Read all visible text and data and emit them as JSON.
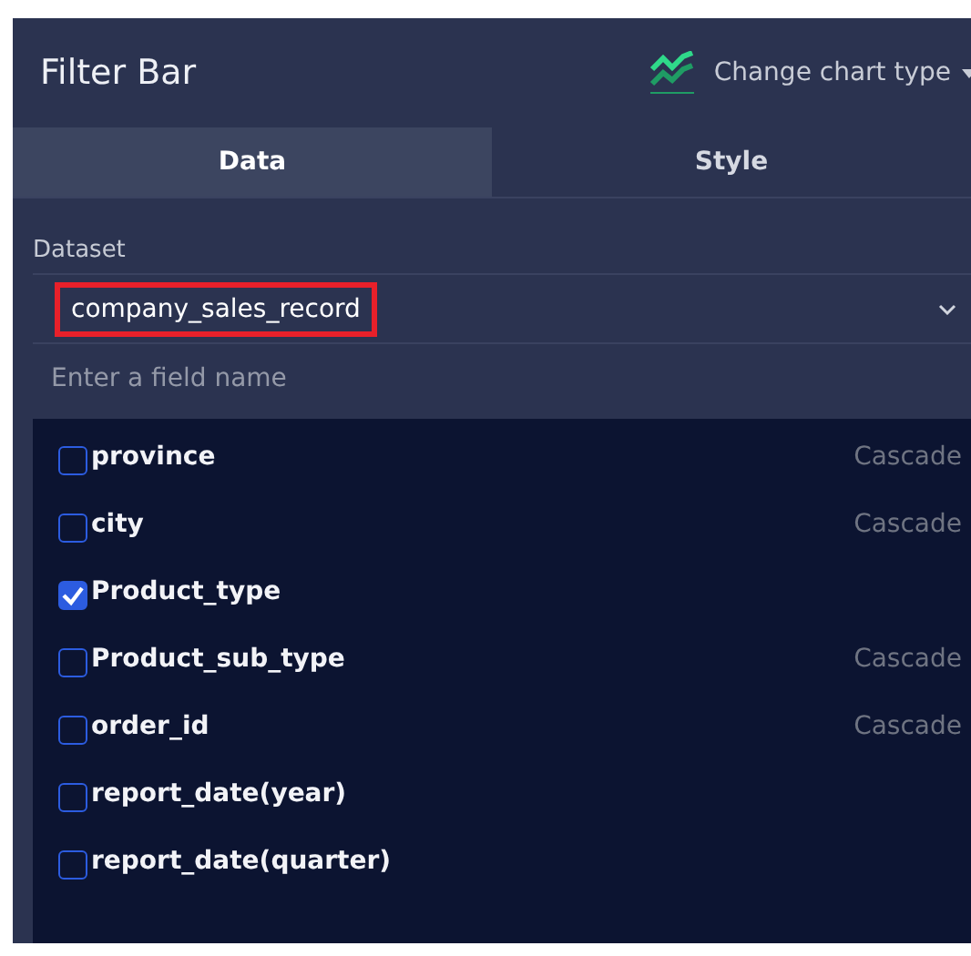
{
  "panel": {
    "title": "Filter Bar",
    "chart_type_button": "Change chart type"
  },
  "tabs": [
    {
      "label": "Data",
      "selected": true
    },
    {
      "label": "Style",
      "selected": false
    }
  ],
  "dataset": {
    "label": "Dataset",
    "value": "company_sales_record",
    "highlighted": true
  },
  "search": {
    "placeholder": "Enter a field name"
  },
  "fields": [
    {
      "name": "province",
      "checked": false,
      "tag": "Cascade"
    },
    {
      "name": "city",
      "checked": false,
      "tag": "Cascade"
    },
    {
      "name": "Product_type",
      "checked": true
    },
    {
      "name": "Product_sub_type",
      "checked": false,
      "tag": "Cascade"
    },
    {
      "name": "order_id",
      "checked": false,
      "tag": "Cascade"
    },
    {
      "name": "report_date(year)",
      "checked": false
    },
    {
      "name": "report_date(quarter)",
      "checked": false
    }
  ]
}
